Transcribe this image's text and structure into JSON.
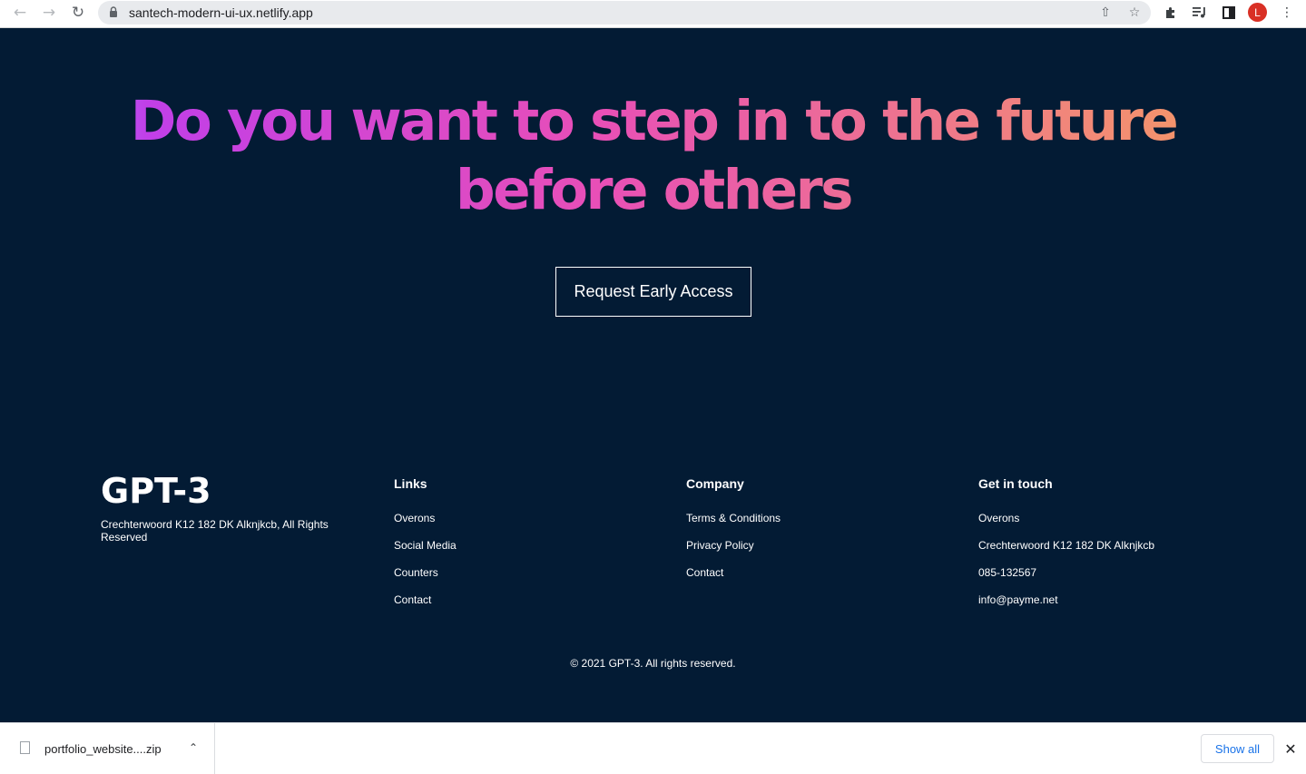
{
  "browser": {
    "url": "santech-modern-ui-ux.netlify.app",
    "back_icon": "back-arrow-icon",
    "forward_icon": "forward-arrow-icon",
    "reload_icon": "reload-icon",
    "profile_initial": "L",
    "profile_color": "#d93025"
  },
  "cta": {
    "headline": "Do you want to step in to the future before others",
    "button_label": "Request Early Access",
    "gradient": [
      "#ae67fa",
      "#f49867"
    ]
  },
  "footer": {
    "logo": "GPT-3",
    "address": "Crechterwoord K12 182 DK Alknjkcb, All Rights Reserved",
    "columns": [
      {
        "title": "Links",
        "items": [
          "Overons",
          "Social Media",
          "Counters",
          "Contact"
        ]
      },
      {
        "title": "Company",
        "items": [
          "Terms & Conditions",
          "Privacy Policy",
          "Contact"
        ]
      },
      {
        "title": "Get in touch",
        "items": [
          "Overons",
          "Crechterwoord K12 182 DK Alknjkcb",
          "085-132567",
          "info@payme.net"
        ]
      }
    ],
    "copyright": "© 2021 GPT-3. All rights reserved.",
    "background": "#031b34"
  },
  "download_shelf": {
    "file_name": "portfolio_website....zip",
    "show_all_label": "Show all"
  }
}
